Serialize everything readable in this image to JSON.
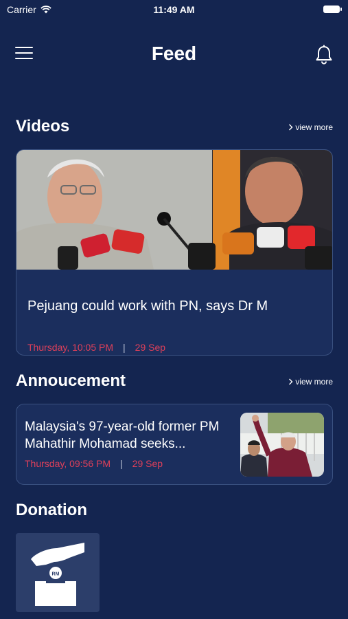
{
  "status_bar": {
    "carrier": "Carrier",
    "time": "11:49 AM"
  },
  "header": {
    "title": "Feed",
    "menu_icon": "hamburger-icon",
    "notification_icon": "bell-icon"
  },
  "videos": {
    "section_title": "Videos",
    "view_more": "view more",
    "card": {
      "title": "Pejuang could work with PN, says Dr M",
      "day_time": "Thursday, 10:05 PM",
      "separator": "|",
      "date": "29 Sep"
    }
  },
  "announcement": {
    "section_title": "Annoucement",
    "view_more": "view more",
    "card": {
      "title": "Malaysia's 97-year-old former PM Mahathir Mohamad seeks...",
      "day_time": "Thursday, 09:56 PM",
      "separator": "|",
      "date": "29 Sep"
    }
  },
  "donation": {
    "section_title": "Donation",
    "icon": "donation-box-icon",
    "coin_label": "RM"
  },
  "colors": {
    "background": "#142550",
    "card": "#1b2e5d",
    "card_border": "#3a5180",
    "meta_red": "#e0405a",
    "text": "#ffffff"
  }
}
